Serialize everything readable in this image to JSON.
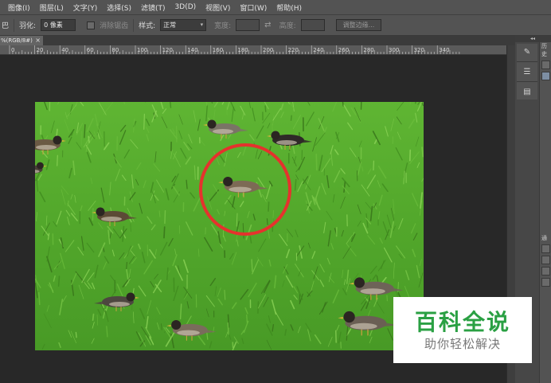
{
  "menu": [
    "图像(I)",
    "图层(L)",
    "文字(Y)",
    "选择(S)",
    "滤镜(T)",
    "3D(D)",
    "视图(V)",
    "窗口(W)",
    "帮助(H)"
  ],
  "options": {
    "feather_label": "羽化:",
    "feather_value": "0 像素",
    "antialias_label": "消除锯齿",
    "style_label": "样式:",
    "style_value": "正常",
    "width_label": "宽度:",
    "height_label": "高度:",
    "refine_edge_label": "调整边缘...",
    "leading_icon_text": "巴"
  },
  "document": {
    "tab_title": "%(RGB/8#)",
    "close_glyph": "×"
  },
  "ruler": {
    "labels": [
      "0",
      "20",
      "40",
      "60",
      "80",
      "100",
      "120",
      "140",
      "160",
      "180",
      "200",
      "220",
      "240",
      "260",
      "280",
      "300",
      "320",
      "340"
    ]
  },
  "panels": {
    "top_tab_label": "历史",
    "side_tab_label": "通"
  },
  "watermark": {
    "title": "百科全说",
    "subtitle": "助你轻松解决"
  },
  "colors": {
    "accent_green": "#2aa043",
    "annotation_circle": "#e5322d",
    "grass": "#54a82c"
  }
}
